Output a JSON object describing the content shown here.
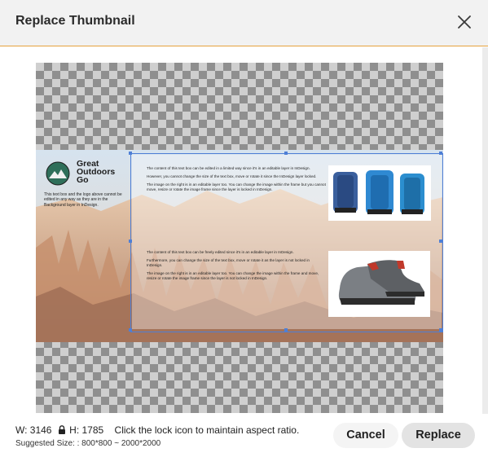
{
  "dialog": {
    "title": "Replace Thumbnail",
    "close_icon": "close-icon",
    "accent_color": "#e6a23c"
  },
  "preview": {
    "logo_text": "Great\nOutdoors\nGo",
    "logo_note": "This text box and the logo above cannot be edited in any way as they are in the Background layer in InDesign.",
    "top_paragraphs": [
      "The content of this text box can be edited in a limited way since it's in an editable layer in InDesign.",
      "However, you cannot change the size of the text box, move or rotate it since the InDesign layer locked.",
      "The image on the right is in an editable layer too. You can change the image within the frame but you cannot move, resize or rotate the image frame since the layer is locked in InDesign."
    ],
    "bottom_paragraphs": [
      "The content of this text box can be freely edited since it's in an editable layer in InDesign.",
      "Furthermore, you can change the size of the text box, move or rotate it as the layer is not locked in InDesign.",
      "The image on the right is in an editable layer too. You can change the image within the frame and move, resize or rotate the image frame since the layer is not locked in InDesign."
    ],
    "frame_color": "#4e7fd6"
  },
  "footer": {
    "width_text": "W: 3146",
    "lock_icon": "lock-icon",
    "height_text": "H: 1785",
    "hint": "Click the lock icon to maintain aspect ratio.",
    "suggested": "Suggested Size: : 800*800 ~ 2000*2000",
    "cancel_label": "Cancel",
    "replace_label": "Replace"
  }
}
